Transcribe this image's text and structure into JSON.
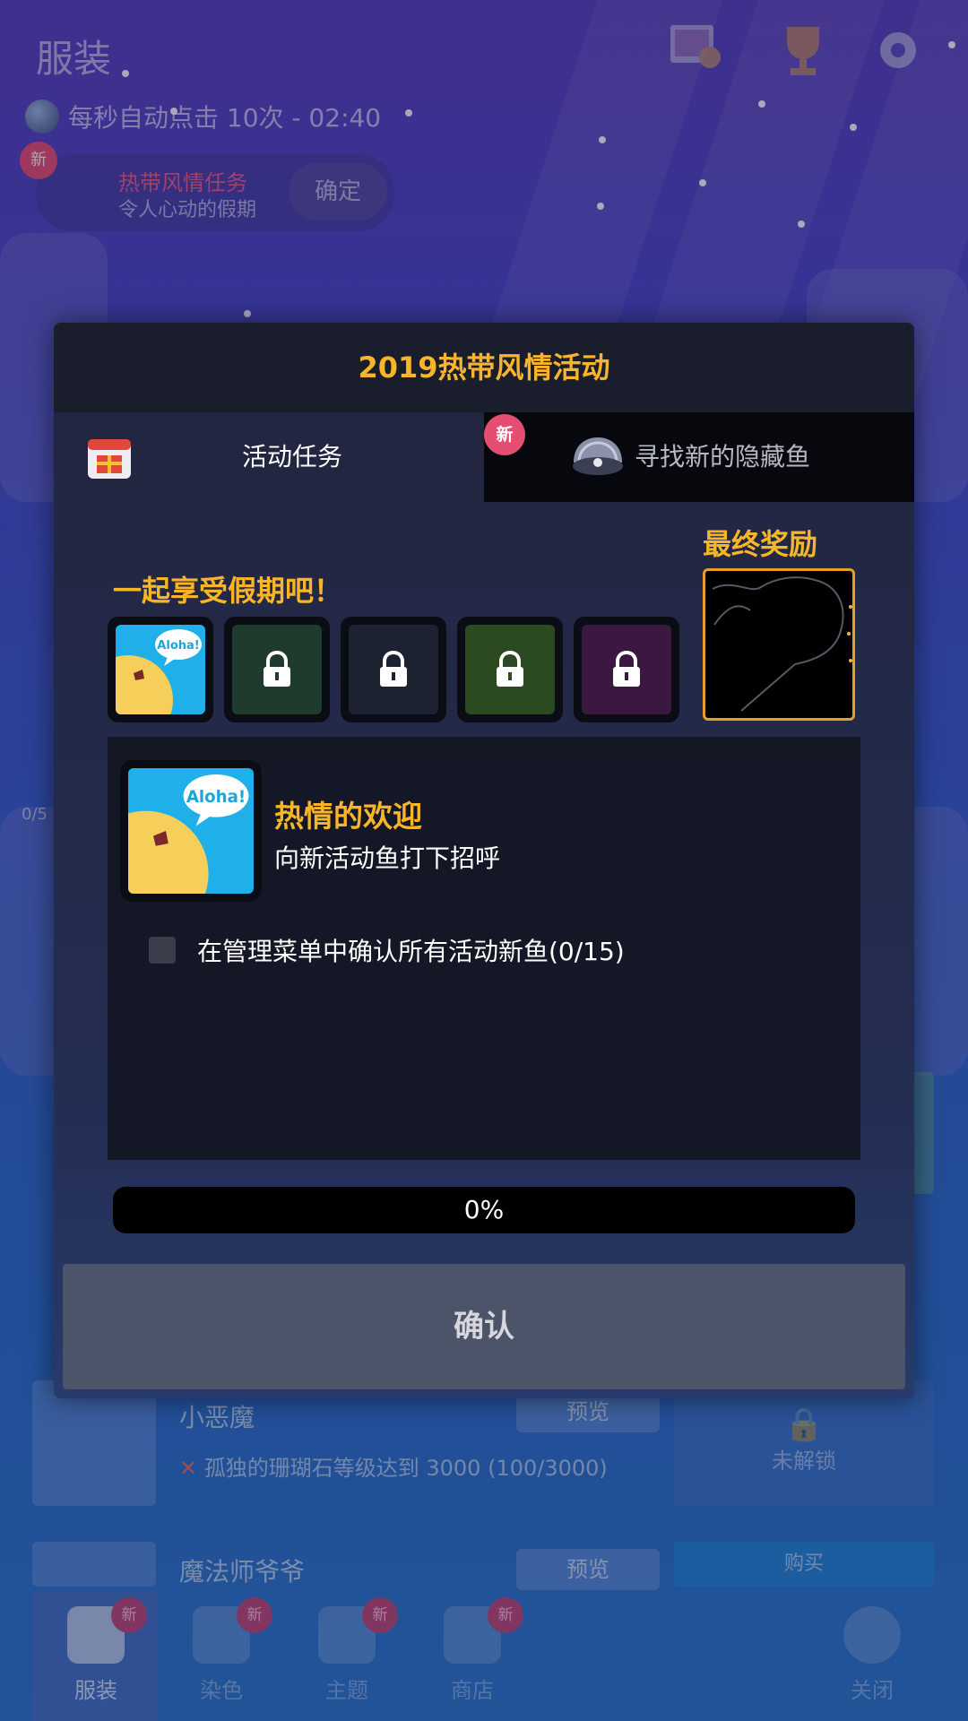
{
  "background": {
    "title": "服装",
    "auto_click": "每秒自动点击 10次 - 02:40",
    "quest": {
      "badge": "新",
      "title": "热带风情任务",
      "subtitle": "令人心动的假期",
      "ok": "确定"
    },
    "progress_small": "0/5",
    "items": [
      {
        "name": "小恶魔",
        "preview": "预览",
        "condition": "孤独的珊瑚石等级达到 3000 (100/3000)",
        "status": "未解锁"
      },
      {
        "name": "魔法师爷爷",
        "preview": "预览",
        "buy": "购买"
      }
    ],
    "tabbar": [
      {
        "label": "服装",
        "badge": "新",
        "icon": "clothes-icon"
      },
      {
        "label": "染色",
        "badge": "新",
        "icon": "dye-icon"
      },
      {
        "label": "主题",
        "badge": "新",
        "icon": "theme-icon"
      },
      {
        "label": "商店",
        "badge": "新",
        "icon": "shop-icon"
      },
      {
        "label": "关闭",
        "icon": "close-icon"
      }
    ]
  },
  "modal": {
    "title": "2019热带风情活动",
    "tabs": [
      {
        "label": "活动任务",
        "icon": "gift-calendar-icon"
      },
      {
        "label": "寻找新的隐藏鱼",
        "icon": "shell-icon",
        "badge": "新"
      }
    ],
    "subtitle": "一起享受假期吧！",
    "final_reward_label": "最终奖励",
    "stages": [
      {
        "locked": false,
        "bubble": "Aloha!"
      },
      {
        "locked": true
      },
      {
        "locked": true
      },
      {
        "locked": true
      },
      {
        "locked": true
      }
    ],
    "detail": {
      "bubble": "Aloha!",
      "title": "热情的欢迎",
      "description": "向新活动鱼打下招呼",
      "task": "在管理菜单中确认所有活动新鱼(0/15)",
      "task_done": false
    },
    "progress_text": "0%",
    "progress_value": 0,
    "confirm_label": "确认"
  },
  "colors": {
    "accent": "#f8b52a",
    "badge": "#e54d72",
    "confirm_bg": "#4b5468"
  }
}
